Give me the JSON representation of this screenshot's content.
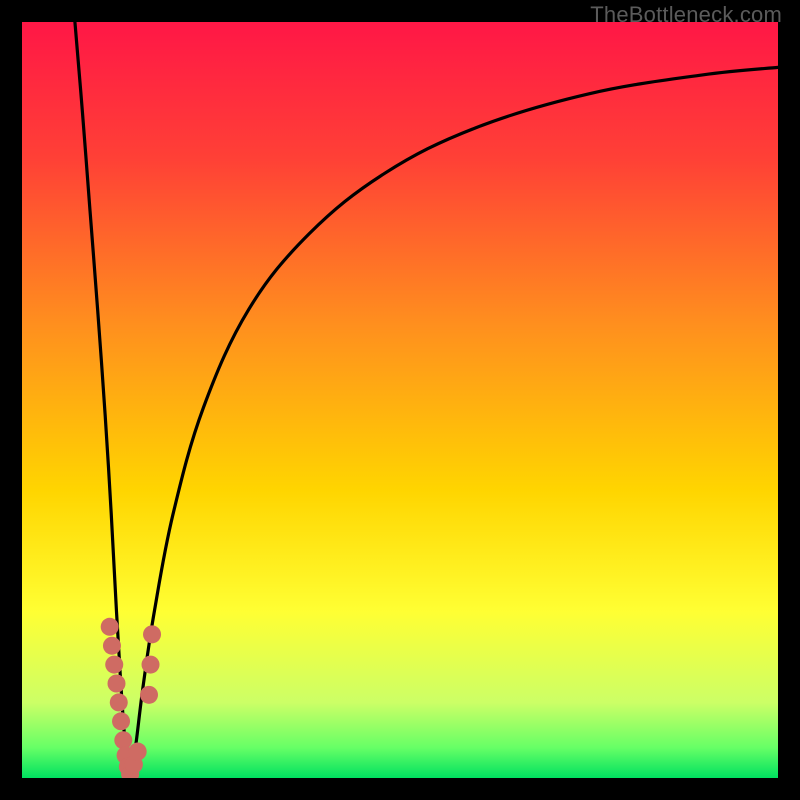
{
  "attribution": {
    "watermark": "TheBottleneck.com"
  },
  "chart_data": {
    "type": "line",
    "title": "",
    "xlabel": "",
    "ylabel": "",
    "xlim": [
      0,
      100
    ],
    "ylim": [
      0,
      100
    ],
    "grid": false,
    "legend": false,
    "background_gradient_stops": [
      {
        "pos": 0.0,
        "color": "#ff1746"
      },
      {
        "pos": 0.18,
        "color": "#ff4036"
      },
      {
        "pos": 0.4,
        "color": "#ff8f1e"
      },
      {
        "pos": 0.62,
        "color": "#ffd500"
      },
      {
        "pos": 0.78,
        "color": "#ffff33"
      },
      {
        "pos": 0.9,
        "color": "#ccff66"
      },
      {
        "pos": 0.96,
        "color": "#66ff66"
      },
      {
        "pos": 1.0,
        "color": "#00e060"
      }
    ],
    "series": [
      {
        "name": "left-curve",
        "color": "#000000",
        "points": [
          {
            "x": 7.0,
            "y": 100.0
          },
          {
            "x": 8.0,
            "y": 88.0
          },
          {
            "x": 9.0,
            "y": 75.0
          },
          {
            "x": 10.0,
            "y": 62.0
          },
          {
            "x": 11.0,
            "y": 48.0
          },
          {
            "x": 11.8,
            "y": 35.0
          },
          {
            "x": 12.5,
            "y": 22.0
          },
          {
            "x": 13.1,
            "y": 12.0
          },
          {
            "x": 13.6,
            "y": 5.0
          },
          {
            "x": 14.0,
            "y": 1.5
          },
          {
            "x": 14.3,
            "y": 0.3
          }
        ]
      },
      {
        "name": "right-curve",
        "color": "#000000",
        "points": [
          {
            "x": 14.3,
            "y": 0.3
          },
          {
            "x": 15.0,
            "y": 4.0
          },
          {
            "x": 16.0,
            "y": 12.0
          },
          {
            "x": 17.5,
            "y": 22.0
          },
          {
            "x": 20.0,
            "y": 35.0
          },
          {
            "x": 24.0,
            "y": 49.0
          },
          {
            "x": 30.0,
            "y": 62.0
          },
          {
            "x": 38.0,
            "y": 72.0
          },
          {
            "x": 48.0,
            "y": 80.0
          },
          {
            "x": 60.0,
            "y": 86.0
          },
          {
            "x": 75.0,
            "y": 90.5
          },
          {
            "x": 90.0,
            "y": 93.0
          },
          {
            "x": 100.0,
            "y": 94.0
          }
        ]
      },
      {
        "name": "marker-trail-left",
        "color": "#cf6b63",
        "marker": true,
        "points": [
          {
            "x": 11.6,
            "y": 20.0
          },
          {
            "x": 11.9,
            "y": 17.5
          },
          {
            "x": 12.2,
            "y": 15.0
          },
          {
            "x": 12.5,
            "y": 12.5
          },
          {
            "x": 12.8,
            "y": 10.0
          },
          {
            "x": 13.1,
            "y": 7.5
          },
          {
            "x": 13.4,
            "y": 5.0
          },
          {
            "x": 13.7,
            "y": 3.0
          },
          {
            "x": 14.0,
            "y": 1.5
          },
          {
            "x": 14.3,
            "y": 0.5
          },
          {
            "x": 14.8,
            "y": 1.8
          },
          {
            "x": 15.3,
            "y": 3.5
          }
        ]
      },
      {
        "name": "marker-trail-right",
        "color": "#cf6b63",
        "marker": true,
        "points": [
          {
            "x": 17.2,
            "y": 19.0
          },
          {
            "x": 17.0,
            "y": 15.0
          },
          {
            "x": 16.8,
            "y": 11.0
          }
        ]
      }
    ]
  }
}
